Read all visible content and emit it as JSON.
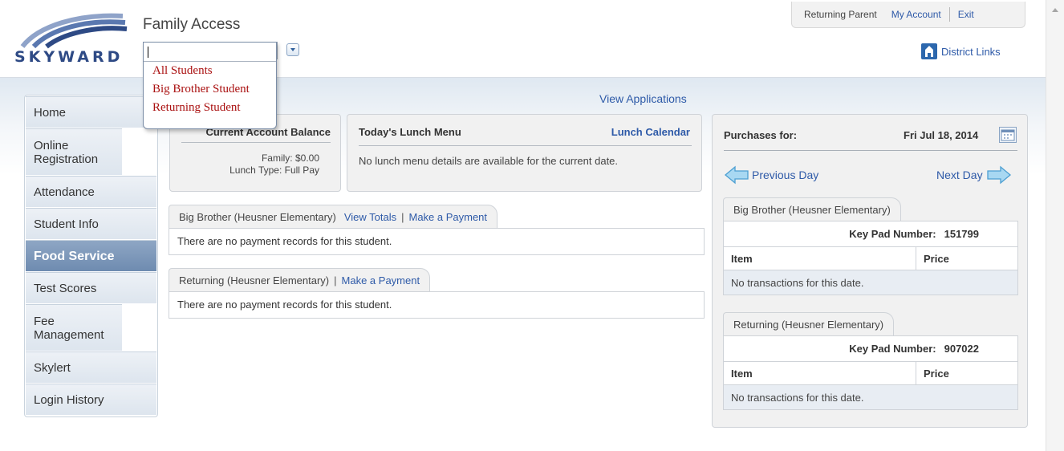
{
  "app": {
    "logo_text": "SKYWARD",
    "title": "Family Access"
  },
  "student_select": {
    "value": "",
    "options": [
      "All Students",
      "Big Brother Student",
      "Returning Student"
    ]
  },
  "topnav": {
    "user": "Returning Parent",
    "my_account": "My Account",
    "exit": "Exit"
  },
  "district_links": "District Links",
  "sidebar": {
    "items": [
      {
        "label": "Home"
      },
      {
        "label": "Online Registration"
      },
      {
        "label": "Attendance"
      },
      {
        "label": "Student Info"
      },
      {
        "label": "Food Service",
        "active": true
      },
      {
        "label": "Test Scores"
      },
      {
        "label": "Fee Management"
      },
      {
        "label": "Skylert"
      },
      {
        "label": "Login History"
      }
    ]
  },
  "view_applications": "View Applications",
  "balance": {
    "title": "Current Account Balance",
    "family_label": "Family:",
    "family_value": "$0.00",
    "lunch_type_label": "Lunch Type:",
    "lunch_type_value": "Full Pay"
  },
  "lunch": {
    "title": "Today's Lunch Menu",
    "calendar_link": "Lunch Calendar",
    "message": "No lunch menu details are available for the current date."
  },
  "payments": [
    {
      "student": "Big Brother (Heusner Elementary)",
      "view_totals": "View Totals",
      "make_payment": "Make a Payment",
      "message": "There are no payment records for this student."
    },
    {
      "student": "Returning (Heusner Elementary)",
      "make_payment": "Make a Payment",
      "message": "There are no payment records for this student."
    }
  ],
  "purchases": {
    "title": "Purchases for:",
    "date": "Fri Jul 18, 2014",
    "previous_day": "Previous Day",
    "next_day": "Next Day",
    "students": [
      {
        "name": "Big Brother (Heusner Elementary)",
        "keypad_label": "Key Pad Number:",
        "keypad_value": "151799",
        "col_item": "Item",
        "col_price": "Price",
        "empty": "No transactions for this date."
      },
      {
        "name": "Returning (Heusner Elementary)",
        "keypad_label": "Key Pad Number:",
        "keypad_value": "907022",
        "col_item": "Item",
        "col_price": "Price",
        "empty": "No transactions for this date."
      }
    ]
  },
  "colors": {
    "link": "#2e5aa8",
    "nav_active": "#7d97b9",
    "dropdown_option": "#aa1111"
  }
}
